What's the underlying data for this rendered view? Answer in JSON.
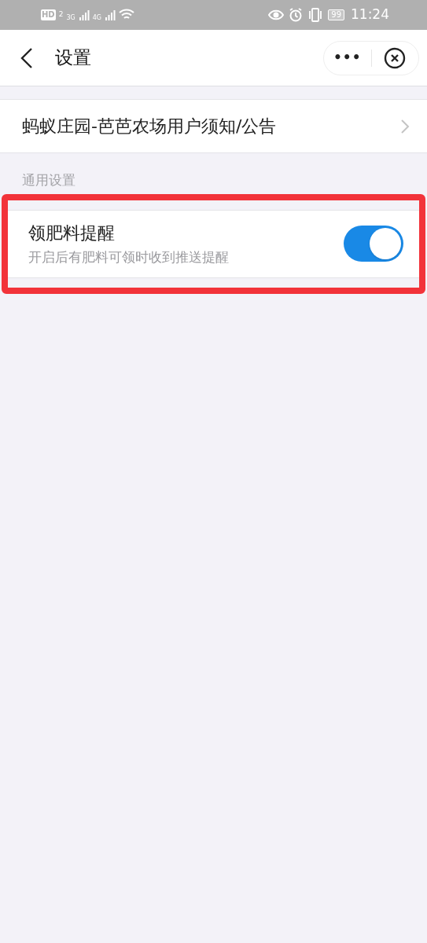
{
  "status_bar": {
    "hd": "HD",
    "sim": "2",
    "net_1": "3G",
    "net_2": "4G",
    "battery": "99",
    "time": "11:24"
  },
  "nav": {
    "title": "设置",
    "more": "•••"
  },
  "notice": {
    "label": "蚂蚁庄园-芭芭农场用户须知/公告"
  },
  "section": {
    "title": "通用设置"
  },
  "settings": [
    {
      "kind": "toggle",
      "title": "领肥料提醒",
      "subtitle": "开启后有肥料可领时收到推送提醒",
      "on": true,
      "highlighted": true
    }
  ]
}
